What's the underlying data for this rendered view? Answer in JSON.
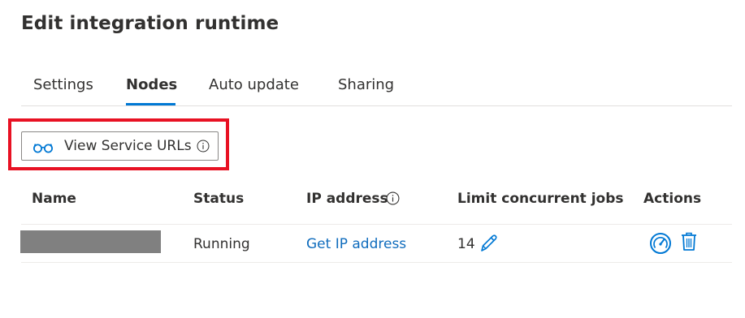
{
  "page": {
    "title": "Edit integration runtime"
  },
  "tabs": [
    {
      "label": "Settings",
      "active": false
    },
    {
      "label": "Nodes",
      "active": true
    },
    {
      "label": "Auto update",
      "active": false
    },
    {
      "label": "Sharing",
      "active": false
    }
  ],
  "toolbar": {
    "view_service_urls_label": "View Service URLs",
    "view_service_urls_icon": "glasses-icon",
    "info_icon": "info-icon"
  },
  "table": {
    "headers": {
      "name": "Name",
      "status": "Status",
      "ip_address": "IP address",
      "limit_concurrent_jobs": "Limit concurrent jobs",
      "actions": "Actions"
    },
    "rows": [
      {
        "name": "",
        "name_redacted": true,
        "status": "Running",
        "ip_address_link": "Get IP address",
        "limit_concurrent_jobs": "14",
        "edit_icon": "pencil-icon",
        "actions": [
          "gauge-icon",
          "trash-icon"
        ]
      }
    ]
  },
  "colors": {
    "accent": "#0078d4",
    "link": "#0f6cbd",
    "highlight": "#e81123",
    "redaction": "#808080"
  }
}
